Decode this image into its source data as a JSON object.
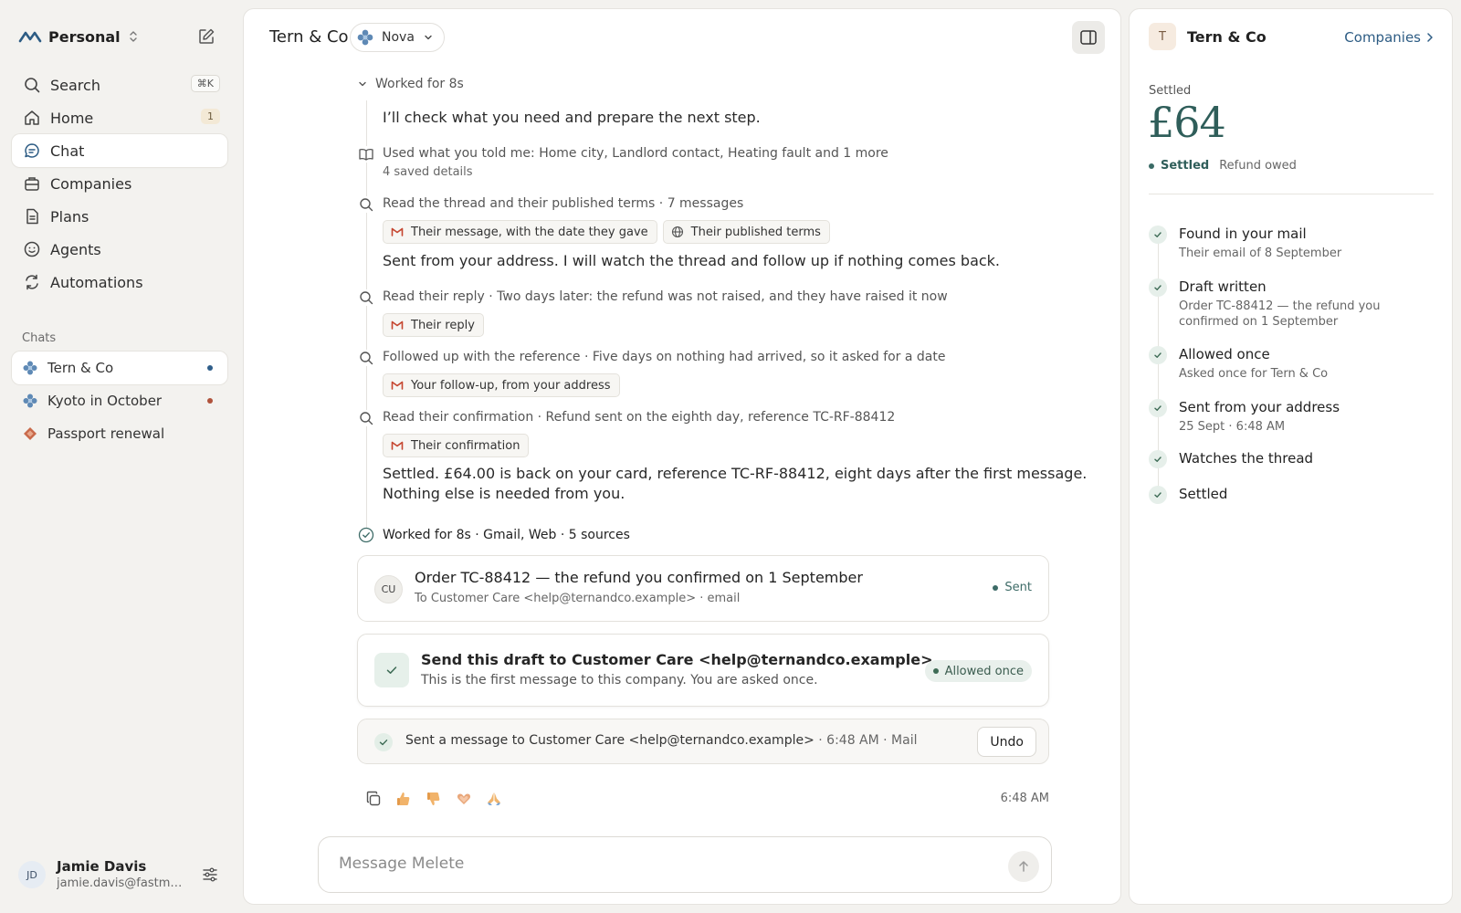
{
  "sidebar": {
    "workspace": "Personal",
    "nav": [
      {
        "label": "Search",
        "shortcut": "⌘K"
      },
      {
        "label": "Home",
        "badge": "1"
      },
      {
        "label": "Chat"
      },
      {
        "label": "Companies"
      },
      {
        "label": "Plans"
      },
      {
        "label": "Agents"
      },
      {
        "label": "Automations"
      }
    ],
    "chats_heading": "Chats",
    "chats": [
      {
        "label": "Tern & Co"
      },
      {
        "label": "Kyoto in October"
      },
      {
        "label": "Passport renewal"
      }
    ],
    "user": {
      "initials": "JD",
      "name": "Jamie Davis",
      "email": "jamie.davis@fastmail.com"
    }
  },
  "header": {
    "title": "Tern & Co",
    "agent": "Nova"
  },
  "thread": {
    "worked_top": "Worked for 8s",
    "steps": {
      "intro": "I’ll check what you need and prepare the next step.",
      "used": "Used what you told me: Home city, Landlord contact, Heating fault and 1 more",
      "used_sub": "4 saved details",
      "read_thread": "Read the thread and their published terms · 7 messages",
      "chip_message": "Their message, with the date they gave",
      "chip_terms": "Their published terms",
      "sent_msg": "Sent from your address. I will watch the thread and follow up if nothing comes back.",
      "read_reply": "Read their reply · Two days later: the refund was not raised, and they have raised it now",
      "chip_reply": "Their reply",
      "followed": "Followed up with the reference · Five days on nothing had arrived, so it asked for a date",
      "chip_followup": "Your follow-up, from your address",
      "read_conf": "Read their confirmation · Refund sent on the eighth day, reference TC-RF-88412",
      "chip_conf": "Their confirmation",
      "settled_line1": "Settled. £64.00 is back on your card, reference TC-RF-88412, eight days after the first message.",
      "settled_line2": "Nothing else is needed from you."
    },
    "worked_bottom": "Worked for 8s · Gmail, Web · 5 sources",
    "email_card": {
      "initials": "CU",
      "title": "Order TC-88412 — the refund you confirmed on 1 September",
      "sub": "To Customer Care <help@ternandco.example> · email",
      "status": "Sent"
    },
    "approval": {
      "title": "Send this draft to Customer Care <help@ternandco.example>",
      "sub": "This is the first message to this company. You are asked once.",
      "badge": "Allowed once"
    },
    "sent_row": {
      "text": "Sent a message to Customer Care <help@ternandco.example>",
      "meta": " · 6:48 AM · Mail",
      "undo": "Undo"
    },
    "time": "6:48 AM"
  },
  "composer": {
    "placeholder": "Message Melete"
  },
  "right_panel": {
    "initial": "T",
    "title": "Tern & Co",
    "link": "Companies",
    "label": "Settled",
    "amount": "£64",
    "status": "Settled",
    "status_note": "Refund owed",
    "steps": [
      {
        "title": "Found in your mail",
        "sub": "Their email of 8 September"
      },
      {
        "title": "Draft written",
        "sub": "Order TC-88412 — the refund you confirmed on 1 September"
      },
      {
        "title": "Allowed once",
        "sub": "Asked once for Tern & Co"
      },
      {
        "title": "Sent from your address",
        "sub": "25 Sept · 6:48 AM"
      },
      {
        "title": "Watches the thread",
        "sub": ""
      },
      {
        "title": "Settled",
        "sub": ""
      }
    ]
  },
  "colors": {
    "accent": "#2f5e5a",
    "link": "#2d5c84",
    "unread_blue": "#2f5e8a",
    "unread_red": "#b0533c"
  }
}
